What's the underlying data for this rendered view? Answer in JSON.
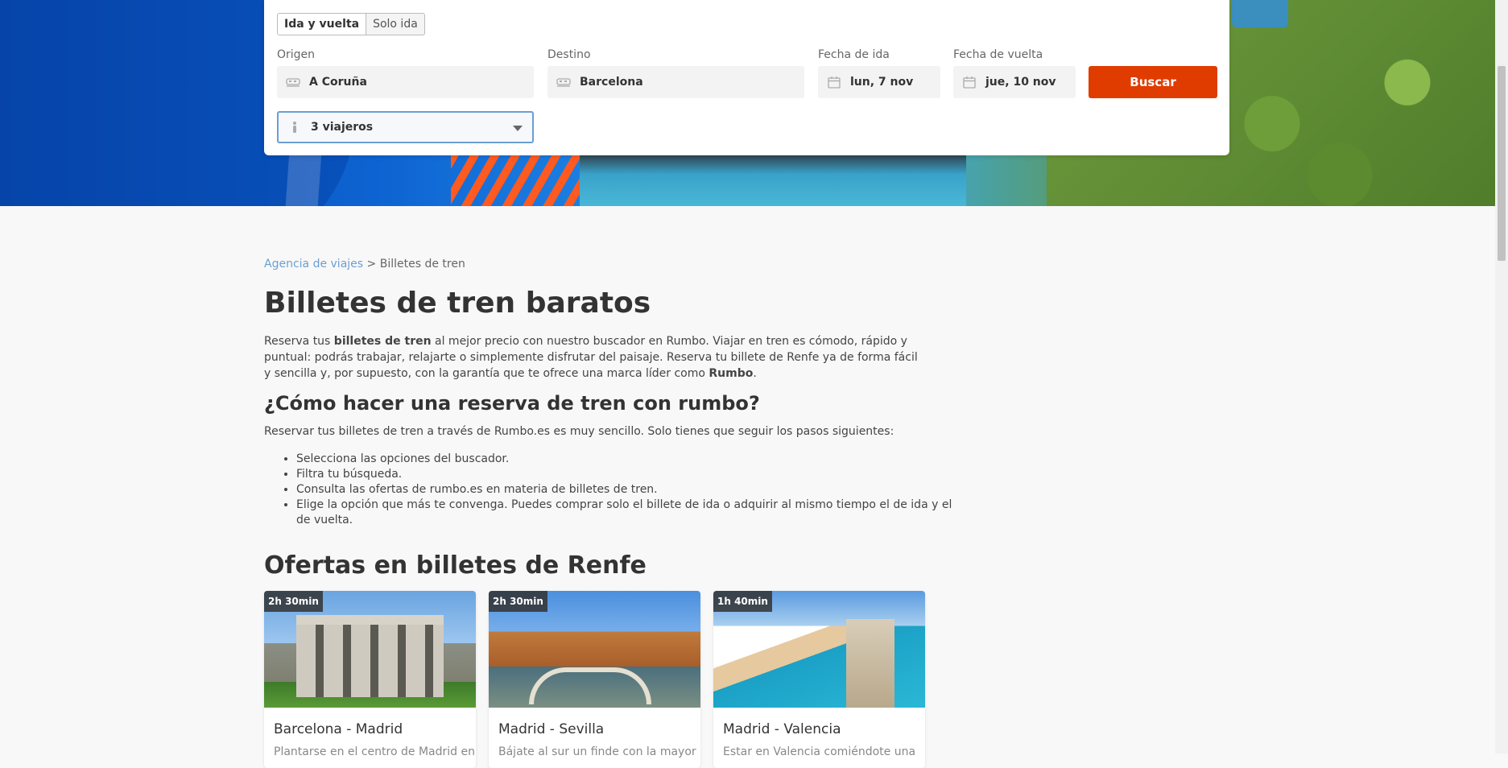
{
  "search": {
    "trip_types": [
      "Ida y vuelta",
      "Solo ida"
    ],
    "origin_label": "Origen",
    "origin_value": "A Coruña",
    "destination_label": "Destino",
    "destination_value": "Barcelona",
    "departure_label": "Fecha de ida",
    "departure_value": "lun, 7 nov",
    "return_label": "Fecha de vuelta",
    "return_value": "jue, 10 nov",
    "search_button": "Buscar",
    "travelers_value": "3 viajeros"
  },
  "breadcrumb": {
    "parent": "Agencia de viajes",
    "separator": ">",
    "current": "Billetes de tren"
  },
  "content": {
    "title": "Billetes de tren baratos",
    "intro_1": "Reserva tus ",
    "intro_bold_1": "billetes de tren",
    "intro_2": " al mejor precio con nuestro buscador en Rumbo. Viajar en tren es cómodo, rápido y puntual: podrás trabajar, relajarte o simplemente disfrutar del paisaje. Reserva tu billete de Renfe ya de forma fácil y sencilla y, por supuesto, con la garantía que te ofrece una marca líder como ",
    "intro_bold_2": "Rumbo",
    "intro_3": ".",
    "howto_title": "¿Cómo hacer una reserva de tren con rumbo?",
    "howto_intro": "Reservar tus billetes de tren a través de Rumbo.es es muy sencillo. Solo tienes que seguir los pasos siguientes:",
    "steps": [
      "Selecciona las opciones del buscador.",
      "Filtra tu búsqueda.",
      "Consulta las ofertas de rumbo.es en materia de billetes de tren.",
      "Elige la opción que más te convenga. Puedes comprar solo el billete de ida o adquirir al mismo tiempo el de ida y el de vuelta."
    ],
    "offers_title": "Ofertas en billetes de Renfe"
  },
  "offers": [
    {
      "duration": "2h 30min",
      "route": "Barcelona - Madrid",
      "desc": "Plantarse en el centro de Madrid en"
    },
    {
      "duration": "2h 30min",
      "route": "Madrid - Sevilla",
      "desc": "Bájate al sur un finde con la mayor"
    },
    {
      "duration": "1h 40min",
      "route": "Madrid - Valencia",
      "desc": "Estar en Valencia comiéndote una"
    }
  ],
  "colors": {
    "accent": "#e03c00",
    "link": "#6a9fd4",
    "hero_blue": "#0d63d1"
  },
  "icons": {
    "origin": "train-icon",
    "destination": "train-icon",
    "date": "calendar-icon",
    "travelers": "person-icon"
  }
}
